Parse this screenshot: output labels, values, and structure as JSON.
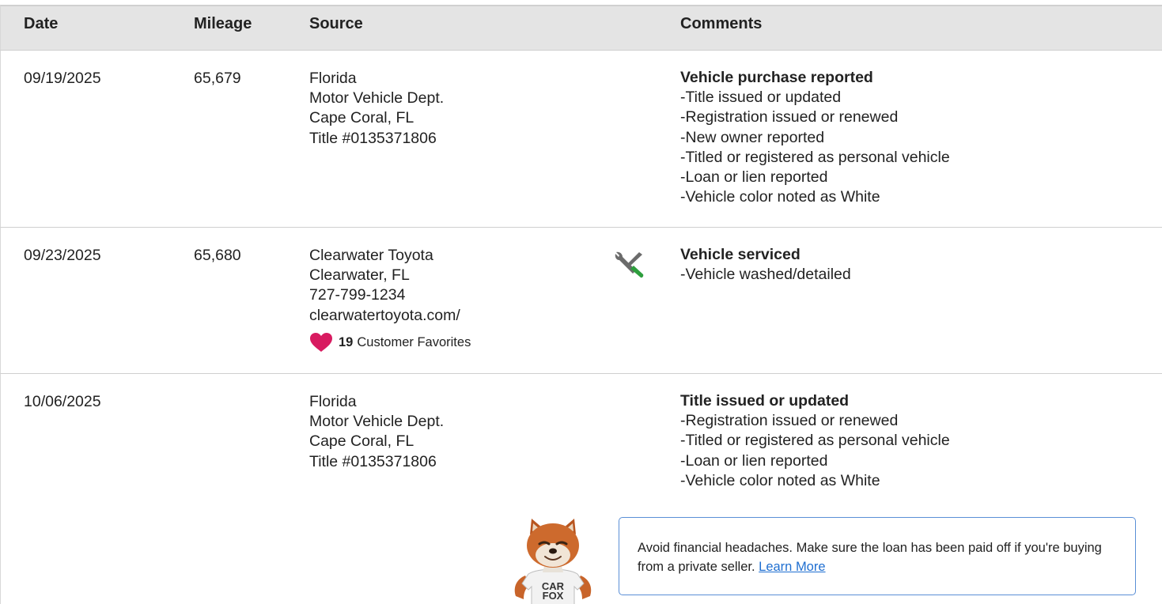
{
  "columns": {
    "date": "Date",
    "mileage": "Mileage",
    "source": "Source",
    "comments": "Comments"
  },
  "records": [
    {
      "date": "09/19/2025",
      "mileage": "65,679",
      "source": [
        "Florida",
        "Motor Vehicle Dept.",
        "Cape Coral, FL",
        "Title #0135371806"
      ],
      "comment_title": "Vehicle purchase reported",
      "comment_items": [
        "-Title issued or updated",
        "-Registration issued or renewed",
        "-New owner reported",
        "-Titled or registered as personal vehicle",
        "-Loan or lien reported",
        "-Vehicle color noted as White"
      ]
    },
    {
      "date": "09/23/2025",
      "mileage": "65,680",
      "source": [
        "Clearwater Toyota",
        "Clearwater, FL",
        "727-799-1234",
        "clearwatertoyota.com/"
      ],
      "favorites_count": "19",
      "favorites_label": "Customer Favorites",
      "service_icon": "wrench-screwdriver-icon",
      "comment_title": "Vehicle serviced",
      "comment_items": [
        "-Vehicle washed/detailed"
      ]
    },
    {
      "date": "10/06/2025",
      "mileage": "",
      "source": [
        "Florida",
        "Motor Vehicle Dept.",
        "Cape Coral, FL",
        "Title #0135371806"
      ],
      "comment_title": "Title issued or updated",
      "comment_items": [
        "-Registration issued or renewed",
        "-Titled or registered as personal vehicle",
        "-Loan or lien reported",
        "-Vehicle color noted as White"
      ]
    }
  ],
  "callout": {
    "text": "Avoid financial headaches. Make sure the loan has been paid off if you're buying from a private seller.",
    "link": "Learn More"
  },
  "mascot": {
    "shirt_line1": "CAR",
    "shirt_line2": "FOX"
  },
  "colors": {
    "header_bg": "#e4e4e4",
    "heart": "#d81b60",
    "link": "#1f6fd1",
    "callout_border": "#5a8fd6"
  }
}
